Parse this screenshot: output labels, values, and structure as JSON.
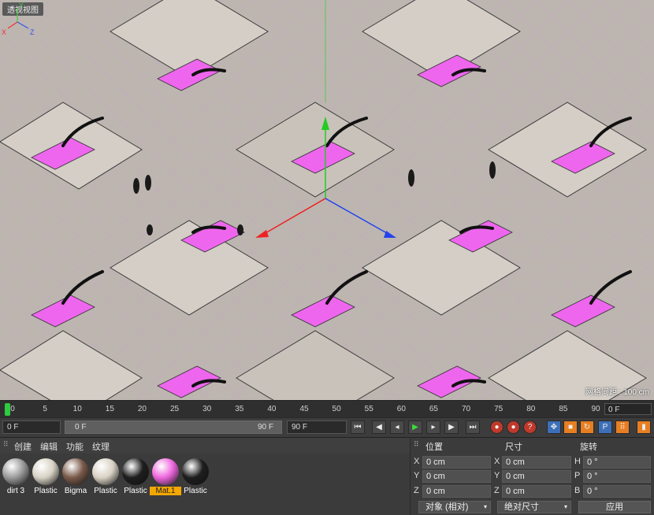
{
  "viewport": {
    "tab_label": "透视视图",
    "grid_readout": "网格间距 : 100 cm"
  },
  "timeline": {
    "ticks": [
      "0",
      "5",
      "10",
      "15",
      "20",
      "25",
      "30",
      "35",
      "40",
      "45",
      "50",
      "55",
      "60",
      "65",
      "70",
      "75",
      "80",
      "85",
      "90"
    ],
    "current_frame": "0 F"
  },
  "transport": {
    "start_field": "0 F",
    "range_start": "0 F",
    "range_end": "90 F",
    "end_field": "90 F"
  },
  "material_menu": {
    "items": [
      "创建",
      "编辑",
      "功能",
      "纹理"
    ]
  },
  "materials": [
    {
      "label": "dirt 3",
      "color": "#9a9a9a"
    },
    {
      "label": "Plastic",
      "color": "#d8d2c4"
    },
    {
      "label": "Bigma",
      "color": "#7a5a4a"
    },
    {
      "label": "Plastic",
      "color": "#d8d2c4"
    },
    {
      "label": "Plastic",
      "color": "#1e1e1e"
    },
    {
      "label": "Mat.1",
      "color": "#ee66dd"
    },
    {
      "label": "Plastic",
      "color": "#1e1e1e"
    }
  ],
  "attributes": {
    "headers": {
      "position": "位置",
      "size": "尺寸",
      "rotation": "旋转"
    },
    "position": [
      {
        "axis": "X",
        "value": "0 cm"
      },
      {
        "axis": "Y",
        "value": "0 cm"
      },
      {
        "axis": "Z",
        "value": "0 cm"
      }
    ],
    "size": [
      {
        "axis": "X",
        "value": "0 cm"
      },
      {
        "axis": "Y",
        "value": "0 cm"
      },
      {
        "axis": "Z",
        "value": "0 cm"
      }
    ],
    "rotation": [
      {
        "axis": "H",
        "value": "0 °"
      },
      {
        "axis": "P",
        "value": "0 °"
      },
      {
        "axis": "B",
        "value": "0 °"
      }
    ],
    "object_mode": "对象 (相对)",
    "size_mode": "绝对尺寸",
    "apply_label": "应用"
  },
  "axis_gizmo": {
    "x": "X",
    "y": "Y",
    "z": "Z"
  }
}
